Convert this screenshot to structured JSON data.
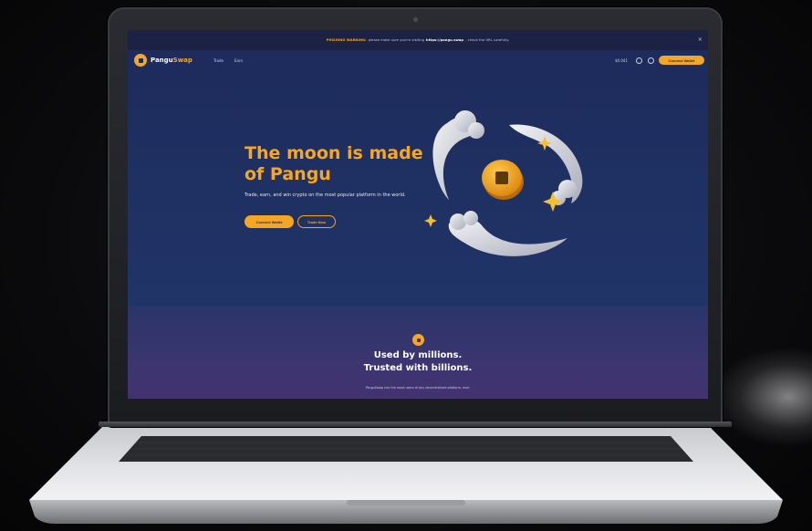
{
  "warning": {
    "label": "PHISHING WARNING:",
    "text_before": "please make sure you're visiting",
    "url": "https://pangu.swap",
    "text_after": "- check the URL carefully."
  },
  "nav": {
    "brand_part1": "Pangu",
    "brand_part2": "Swap",
    "links": [
      "Trade",
      "Earn"
    ],
    "balance": "$0.041",
    "connect_label": "Connect Wallet"
  },
  "hero": {
    "title": "The moon is made of Pangu",
    "subtitle": "Trade, earn, and win crypto on the most popular platform in the world.",
    "connect_label": "Connect Wallet",
    "trade_label": "Trade Now"
  },
  "stats": {
    "title_line1": "Used by millions.",
    "title_line2": "Trusted with billions.",
    "subtitle": "PanguSwap has the most users of any decentralized platform, ever."
  },
  "colors": {
    "accent": "#f5a623",
    "hero_bg": "#1d2c5c",
    "lower_bg": "#3b3570"
  },
  "icons": [
    "pangu-coin-icon",
    "globe-icon",
    "gear-icon",
    "close-icon"
  ]
}
